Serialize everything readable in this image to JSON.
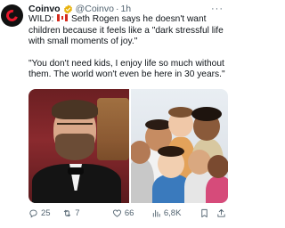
{
  "author": {
    "name": "Coinvo",
    "handle": "@Coinvo",
    "separator": "·",
    "time": "1h",
    "avatar_icon": "coinvo-logo-icon",
    "verified_icon": "verified-badge-icon",
    "verified_color": "#e8b20c"
  },
  "more_icon": "more-options-icon",
  "more_label": "···",
  "tweet": {
    "prefix": "WILD:",
    "flag_icon": "canada-flag-icon",
    "line1": "Seth Rogen says he doesn't want children because it feels like a \"dark stressful life with small moments of joy.\"",
    "line2": "\"You don't need kids, I enjoy life so much without them. The world won't even be here in 30 years.\""
  },
  "media": {
    "left_photo": "seth-rogen-photo",
    "right_photo": "children-group-photo"
  },
  "actions": {
    "replies": "25",
    "retweets": "7",
    "likes": "66",
    "views": "6,8K"
  },
  "colors": {
    "text": "#0f1419",
    "muted": "#536471",
    "brand": "#e8182c"
  }
}
